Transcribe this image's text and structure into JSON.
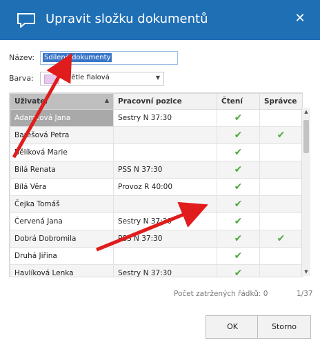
{
  "window": {
    "title": "Upravit složku dokumentů",
    "close_glyph": "✕"
  },
  "form": {
    "name_label": "Název:",
    "name_value": "Sdílené dokumenty",
    "color_label": "Barva:",
    "color_value": "Světle fialová",
    "color_swatch": "#e8c8ec"
  },
  "grid": {
    "columns": [
      "Uživatel",
      "Pracovní pozice",
      "Čtení",
      "Správce"
    ],
    "sorted_column": "Uživatel",
    "check_glyph": "✔",
    "rows": [
      {
        "user": "Adamcová Jana",
        "position": "Sestry N 37:30",
        "read": true,
        "admin": false,
        "selected": true
      },
      {
        "user": "Barešová Petra",
        "position": "",
        "read": true,
        "admin": true
      },
      {
        "user": "Bělíková Marie",
        "position": "",
        "read": true,
        "admin": false
      },
      {
        "user": "Bílá Renata",
        "position": "PSS N 37:30",
        "read": true,
        "admin": false
      },
      {
        "user": "Bílá Věra",
        "position": "Provoz R 40:00",
        "read": true,
        "admin": false
      },
      {
        "user": "Čejka Tomáš",
        "position": "",
        "read": true,
        "admin": false
      },
      {
        "user": "Červená Jana",
        "position": "Sestry N 37:30",
        "read": true,
        "admin": false
      },
      {
        "user": "Dobrá Dobromila",
        "position": "PSS N 37:30",
        "read": true,
        "admin": true
      },
      {
        "user": "Druhá Jiřina",
        "position": "",
        "read": true,
        "admin": false
      },
      {
        "user": "Havlíková Lenka",
        "position": "Sestry N 37:30",
        "read": true,
        "admin": false
      }
    ]
  },
  "footer": {
    "count_text": "Počet zatržených řádků: 0",
    "page_text": "1/37"
  },
  "buttons": {
    "ok": "OK",
    "cancel": "Storno"
  },
  "colors": {
    "titlebar": "#1f6fb5",
    "check": "#4bab3b",
    "annotation_arrow": "#e01c1c"
  }
}
